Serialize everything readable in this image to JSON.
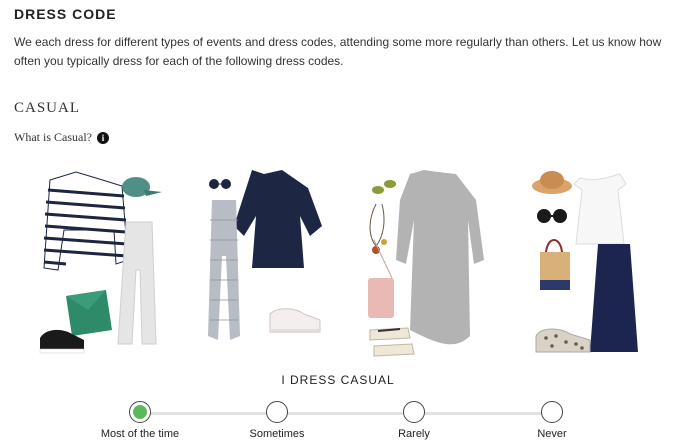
{
  "section": {
    "title": "DRESS CODE",
    "intro": "We each dress for different types of events and dress codes, attending some more regularly than others. Let us know how often you typically dress for each of the following dress codes."
  },
  "dress_code": {
    "name": "CASUAL",
    "what_is": "What is Casual?",
    "info_icon": "i"
  },
  "frequency": {
    "question": "I DRESS CASUAL",
    "options": [
      {
        "label": "Most of the time",
        "selected": true
      },
      {
        "label": "Sometimes",
        "selected": false
      },
      {
        "label": "Rarely",
        "selected": false
      },
      {
        "label": "Never",
        "selected": false
      }
    ],
    "selected_color": "#5cb85c"
  },
  "outfits": [
    {
      "icons": [
        "striped-top-icon",
        "cap-icon",
        "grey-jogger-icon",
        "clutch-icon",
        "sneaker-icon"
      ]
    },
    {
      "icons": [
        "sunglasses-icon",
        "navy-blouse-icon",
        "check-pants-icon",
        "white-sneaker-icon"
      ]
    },
    {
      "icons": [
        "earrings-icon",
        "necklace-icon",
        "grey-dress-icon",
        "crossbody-bag-icon",
        "sandal-icon"
      ]
    },
    {
      "icons": [
        "straw-hat-icon",
        "sunglasses-icon",
        "white-top-icon",
        "tote-bag-icon",
        "navy-skirt-icon",
        "leopard-sneaker-icon"
      ]
    }
  ]
}
